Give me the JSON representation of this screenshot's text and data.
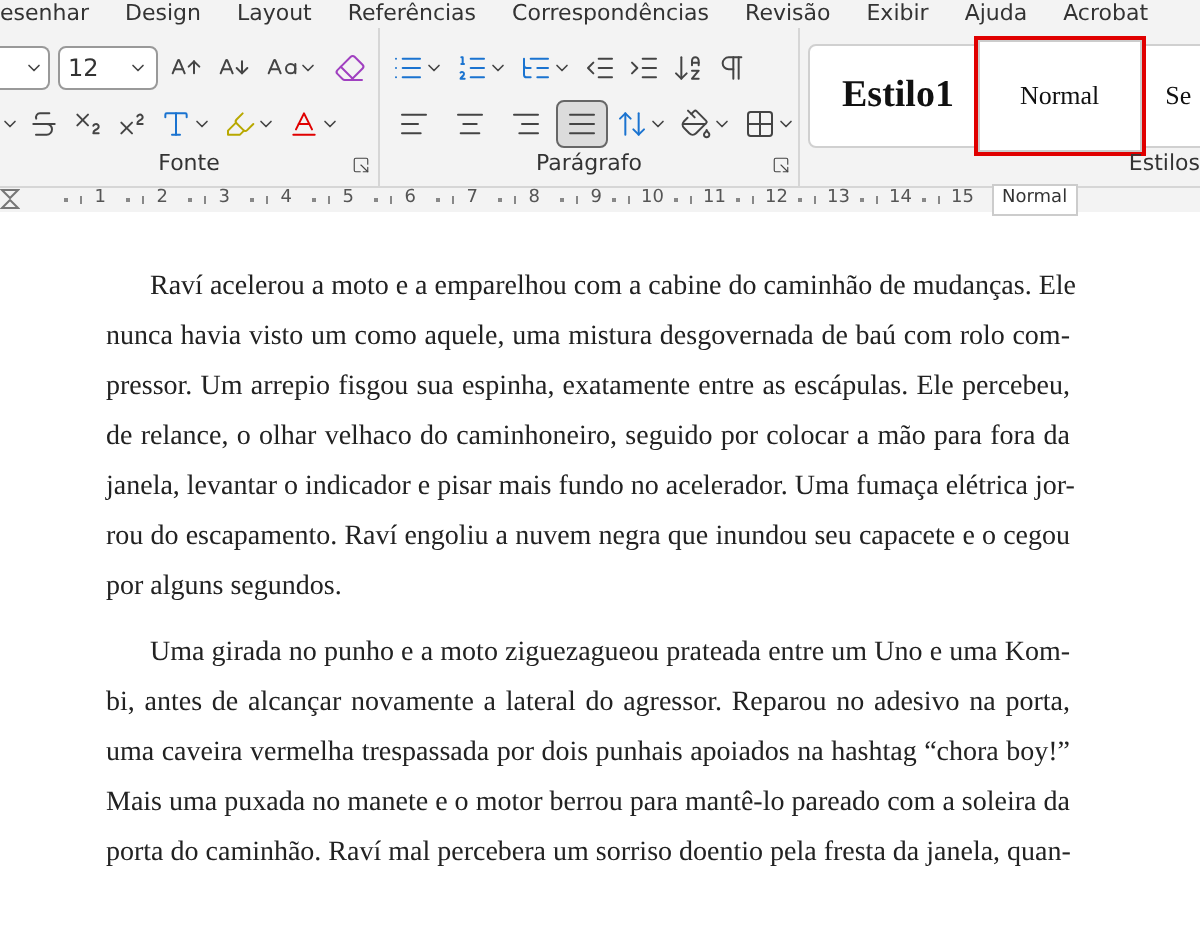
{
  "tabs": [
    "esenhar",
    "Design",
    "Layout",
    "Referências",
    "Correspondências",
    "Revisão",
    "Exibir",
    "Ajuda",
    "Acrobat"
  ],
  "font_group": {
    "font_size": "12",
    "label": "Fonte"
  },
  "paragraph_group": {
    "label": "Parágrafo",
    "alignment": [
      {
        "kind": "left",
        "selected": false
      },
      {
        "kind": "center",
        "selected": false
      },
      {
        "kind": "right",
        "selected": false
      },
      {
        "kind": "justify",
        "selected": true
      }
    ]
  },
  "styles_group": {
    "label": "Estilos",
    "styles": [
      {
        "label": "Estilo1",
        "kind": "heading",
        "selected": false
      },
      {
        "label": "Normal",
        "kind": "body",
        "selected": true
      },
      {
        "label": "Se",
        "kind": "body",
        "selected": false
      }
    ]
  },
  "tooltip": "Normal",
  "ruler": [
    "1",
    "2",
    "3",
    "4",
    "5",
    "6",
    "7",
    "8",
    "9",
    "10",
    "11",
    "12",
    "13",
    "14",
    "15"
  ],
  "paragraphs": [
    {
      "lines": [
        "Raví acelerou a moto e a emparelhou com a cabine do caminhão de mudanças. Ele",
        "nunca havia visto um como aquele, uma mistura desgovernada de baú com rolo com-",
        "pressor. Um arrepio fisgou sua espinha, exatamente entre as escápulas. Ele percebeu,",
        "de relance, o olhar velhaco do caminhoneiro, seguido por colocar a mão para fora da",
        "janela, levantar o indicador e pisar mais fundo no acelerador. Uma fumaça elétrica jor-",
        "rou do escapamento. Raví engoliu a nuvem negra que inundou seu capacete e o cegou",
        "por alguns segundos."
      ]
    },
    {
      "lines": [
        "Uma girada no punho e a moto ziguezagueou prateada entre um Uno e uma Kom-",
        "bi, antes de alcançar novamente a lateral do agressor. Reparou no adesivo na porta,",
        "uma caveira vermelha trespassada por dois punhais apoiados na hashtag “chora boy!”",
        "Mais uma puxada no manete e o motor berrou para mantê-lo pareado com a soleira da",
        "porta do caminhão. Raví mal percebera um sorriso doentio pela fresta da janela, quan-"
      ]
    }
  ]
}
